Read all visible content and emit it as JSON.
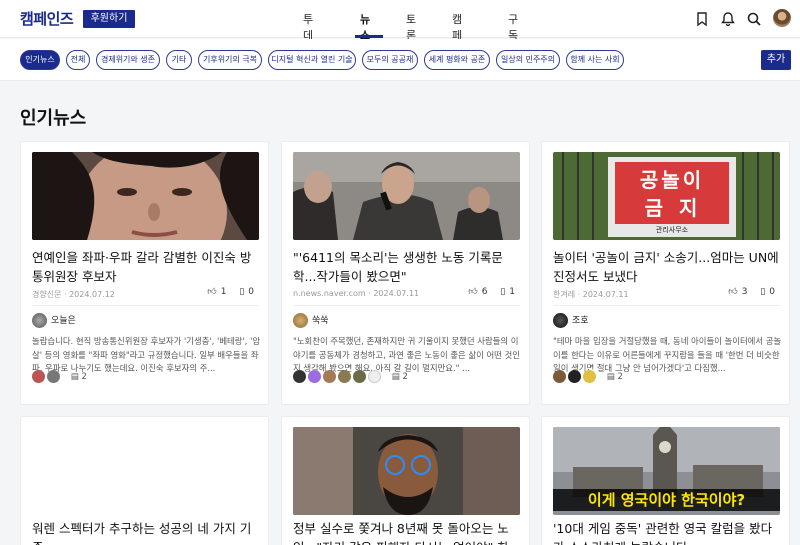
{
  "header": {
    "logo": "캠페인즈",
    "donate_label": "후원하기",
    "nav": [
      "투데이",
      "뉴스",
      "토론",
      "캠페인",
      "구독"
    ],
    "active_nav": "뉴스"
  },
  "tags": {
    "items": [
      "인기뉴스",
      "전체",
      "경제위기와 생존",
      "기타",
      "기후위기의 극복",
      "디지털 혁신과 열린 기술",
      "모두의 공공재",
      "세계 평화와 공존",
      "일상의 민주주의",
      "함께 사는 사회"
    ],
    "add_label": "추가"
  },
  "section_title": "인기뉴스",
  "cards": [
    {
      "title": "연예인을 좌파·우파 갈라 감별한 이진숙 방통위원장 후보자",
      "source": "경향신문",
      "date": "2024.07.12",
      "likes": "1",
      "bookmarks": "0",
      "author": "오늘은",
      "excerpt": "놀랍습니다. 현직 방송통신위원장 후보자가 '기생충', '베테랑', '암살' 등의 영화를 \"좌파 영화\"라고 규정했습니다. 일부 배우들을 좌파, 우파로 나누기도 했는데요. 이진숙 후보자의 주...",
      "comments": "2"
    },
    {
      "title": "\"'6411의 목소리'는 생생한 노동 기록문학...작가들이 봤으면\"",
      "source": "n.news.naver.com",
      "date": "2024.07.11",
      "likes": "6",
      "bookmarks": "1",
      "author": "쑥쑥",
      "excerpt": "\"노회찬이 주목했던, 존재하지만 귀 기울이지 못했던 사람들의 이야기를 공동체가 경청하고, 과연 좋은 노동이 좋은 삶이 어떤 것인지 생각해 봤으면 해요. 아직 갈 길이 멀지만요.\" ...",
      "comments": "2"
    },
    {
      "title": "놀이터 '공놀이 금지' 소송기...엄마는 UN에 진정서도 보냈다",
      "source": "한겨레",
      "date": "2024.07.11",
      "likes": "3",
      "bookmarks": "0",
      "author": "조호",
      "excerpt": "\"테마 마을 입장을 거절당했을 때, 동네 아이들이 놀이터에서 공놀이를 한다는 이유로 어른들에게 꾸지람을 들을 때 '한번 더 비슷한 일이 생기면 절대 그냥 안 넘어가겠다'고 다짐했...",
      "comments": "2",
      "sign_line1": "공놀이",
      "sign_line2": "금지",
      "sign_small": "관리사무소"
    },
    {
      "title": "워렌 스펙터가 추구하는 성공의 네 가지 기준"
    },
    {
      "title": "정부 실수로 쫓겨나 8년째 못 돌아오는 노인...\"자기 같은 피해자 다시는 없어야\" 한"
    },
    {
      "title": "'10대 게임 중독' 관련한 영국 칼럼을 봤다가 소스라치게 놀랐습니다",
      "overlay": "이게 영국이야 한국이야?"
    }
  ],
  "colors": {
    "brand": "#1a2b8c"
  }
}
